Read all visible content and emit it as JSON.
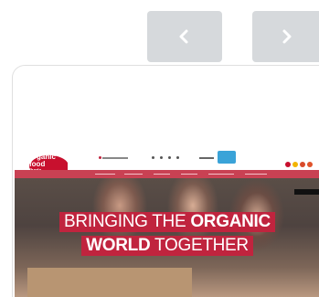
{
  "carousel": {
    "prev_icon": "chevron-left-icon",
    "next_icon": "chevron-right-icon",
    "button_color": "#d6d9dc"
  },
  "site": {
    "logo_lines": [
      "organic",
      "food",
      "iberia"
    ],
    "headline_line1_light": "BRINGING THE ",
    "headline_line1_bold": "ORGANIC",
    "headline_line2_bold": "WORLD",
    "headline_line2_light": " TOGETHER",
    "accent_color": "#c0243e",
    "menu_color": "#c94153"
  }
}
